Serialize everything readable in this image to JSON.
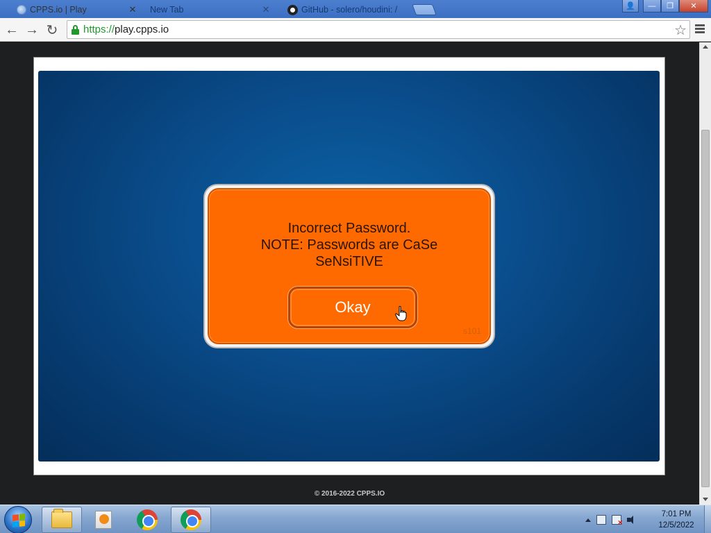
{
  "browser": {
    "tabs": [
      {
        "title": "CPPS.io | Play",
        "close": "✕",
        "icon": "globe-icon",
        "active": true
      },
      {
        "title": "New Tab",
        "close": "✕",
        "icon": "none",
        "active": false
      },
      {
        "title": "GitHub - solero/houdini: /",
        "close": "✕",
        "icon": "github-icon",
        "active": false
      }
    ],
    "window_controls": {
      "user": "👤",
      "minimize": "—",
      "maximize": "❐",
      "close": "✕"
    },
    "toolbar": {
      "back": "←",
      "forward": "→",
      "reload": "↻"
    },
    "address": {
      "scheme": "https://",
      "host": "play.cpps.io",
      "star": "☆"
    }
  },
  "dialog": {
    "message_line1": "Incorrect Password.",
    "message_line2": "NOTE: Passwords are CaSe",
    "message_line3": "SeNsiTIVE",
    "okay_label": "Okay",
    "code": "s101"
  },
  "footer": {
    "copyright": "© 2016-2022 CPPS.IO"
  },
  "taskbar": {
    "apps": [
      "windows-explorer",
      "windows-media-player",
      "google-chrome",
      "google-chrome"
    ],
    "clock": {
      "time": "7:01 PM",
      "date": "12/5/2022"
    }
  },
  "colors": {
    "dialog_orange": "#ff6a00",
    "stage_blue": "#0a4d8c",
    "titlebar_blue": "#3b6fc2"
  }
}
